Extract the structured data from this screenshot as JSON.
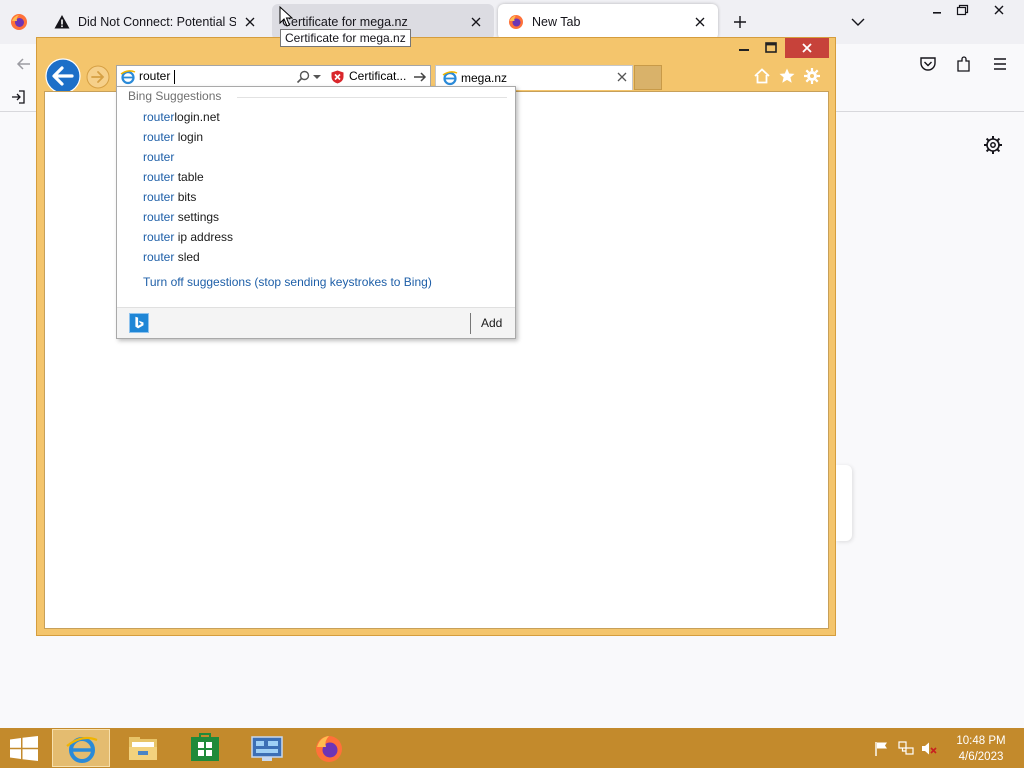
{
  "firefox": {
    "tabs": [
      {
        "title": "Did Not Connect: Potential Security Issue",
        "icon": "warning-icon"
      },
      {
        "title": "Certificate for mega.nz",
        "icon": "none"
      },
      {
        "title": "New Tab",
        "icon": "firefox-icon"
      }
    ],
    "tooltip": "Certificate for mega.nz"
  },
  "ie": {
    "address_value": "router",
    "cert_label": "Certificat...",
    "tab_title": "mega.nz",
    "suggestions": {
      "header": "Bing Suggestions",
      "typed": "router",
      "items": [
        {
          "typed": "router",
          "rest": "login.net"
        },
        {
          "typed": "router",
          "rest": " login"
        },
        {
          "typed": "router",
          "rest": ""
        },
        {
          "typed": "router",
          "rest": " table"
        },
        {
          "typed": "router",
          "rest": " bits"
        },
        {
          "typed": "router",
          "rest": " settings"
        },
        {
          "typed": "router",
          "rest": " ip address"
        },
        {
          "typed": "router",
          "rest": " sled"
        }
      ],
      "turn_off": "Turn off suggestions (stop sending keystrokes to Bing)",
      "add_label": "Add"
    }
  },
  "taskbar": {
    "time": "10:48 PM",
    "date": "4/6/2023"
  },
  "colors": {
    "ie_frame": "#f4c56c",
    "taskbar": "#c38a2c",
    "link_blue": "#1e5fa8",
    "close_red": "#c7423a"
  }
}
